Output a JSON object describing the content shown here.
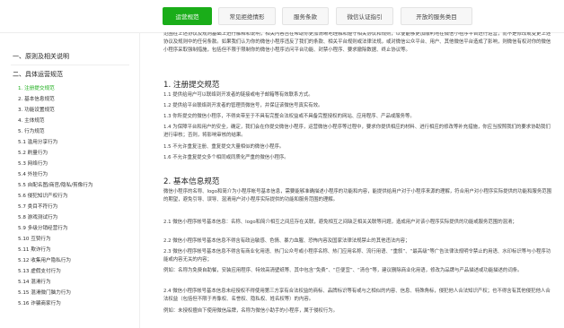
{
  "tabs": [
    {
      "label": "运营规范"
    },
    {
      "label": "常见拒绝情形"
    },
    {
      "label": "服务条款"
    },
    {
      "label": "微信认证指引"
    },
    {
      "label": "开放的服务类目"
    }
  ],
  "sidebar": {
    "sections": [
      {
        "label": "一、原则及相关说明"
      },
      {
        "label": "二、具体运营规范"
      }
    ],
    "items": [
      {
        "label": "1. 注册提交规范"
      },
      {
        "label": "2. 基本信息规范"
      },
      {
        "label": "3. 功能设置规范"
      },
      {
        "label": "4. 主体规范"
      },
      {
        "label": "5. 行为规范"
      },
      {
        "label": "5.1 滥用分享行为"
      },
      {
        "label": "5.2 刷量行为"
      },
      {
        "label": "5.3 网络行为"
      },
      {
        "label": "5.4 外挂行为"
      },
      {
        "label": "5.5 自配名图/商官/隐私/剪像行为"
      },
      {
        "label": "5.6 侵犯知识产权行为"
      },
      {
        "label": "5.7 类目不符行为"
      },
      {
        "label": "5.8 游戏测试行为"
      },
      {
        "label": "5.9 多级分销经营行为"
      },
      {
        "label": "5.10 互赞行为"
      },
      {
        "label": "5.11 欺诈行为"
      },
      {
        "label": "5.12 收集用户隐私行为"
      },
      {
        "label": "5.13 虚假支付行为"
      },
      {
        "label": "5.14 混淆行为"
      },
      {
        "label": "5.15 混淆微门脑力行为"
      },
      {
        "label": "5.16 诈骗商家行为"
      }
    ]
  },
  "content": {
    "intro": "范围在上述协议及规则基础上进行解释和说明，相关内容旨在帮助你更加清晰地理解和遵守相关协议和规则，以便能够更加顺利地在微信小程序平台进行运营，而不是修改或变更上述协议及规则中的任何条款。如果我们认为你的微信小程序违反了我们的条款、相关平台规则或法律法规，或对微信公众平台、用户、其他微信平台造成了影响，则微信有权对你的微信小程序采取强制措施，包括但不限于限制你的微信小程序访问平台功能、封禁小程序、要求撤除数据、终止协议等。",
    "section1": {
      "title": "1. 注册提交规范",
      "items": [
        "1.1 提供给用户可以联络到开发者的链接或电子邮箱等有效联系方式。",
        "1.2 提供给平台联络到开发者的管理员微信号，并保证该微信号真实有效。",
        "1.3 你所提交的微信小程序，不得夹带至于不具有完整合法权益或不具备完整授权的网站、应用程序、产品或服务等。",
        "1.4 为保障平台和用户的安全，确定，我们会在你提交微信小程序，运营微信小程序等过程中，要求你提供相应的材料、进行相应的修改等补充措施，你应当按照我们的要求协助我们进行审核；否则，将影响审核的结果。",
        "1.5 不允许重复注册、重复提交大量相似的微信小程序。",
        "1.6 不允许重复提交多个相同或同质化严重的微信小程序。"
      ]
    },
    "section2": {
      "title": "2. 基本信息规范",
      "intro": "微信小程序的名称、logo和简介为小程序帐号基本信息，需要能够准确描述小程序的功能和内容，能提供给用户对于小程序来源的理解，符合用户对小程序实际提供的功能和服务范围的期望，避免引导、误导、混淆用户对小程序实际提供的功能和服务范围的理解。",
      "items": [
        "2.1 微信小程序帐号基本信息：名称、logo和简介相互之间应存在关联，避免相互之间缺乏相关关联等问题，造成用户对该小程序实际提供的功能或服务范围的混淆；",
        "2.2 微信小程序帐号基本信息不得含有政治敏感、色情、暴力血腥、恐怖内容及国家法律法规禁止的其他违法内容；",
        "2.3 微信小程序帐号基本信息不得含有商业化用语、热门公众号或小程序名称、热门应用名称、流行用语、“重叙”、“最高级”等广告法律法规明令禁止的用语、水印标识等与小程序功能或内容无关的内容；",
        "例如：名称为免费自助餐，安装应用程序、特效高清壁纸等、其中包含“免费”、“巨便宜”、“清仓”等，建议删除商业化用语，修改为品牌与产品描述或功能描述的词条。",
        "2.4 微信小程序帐号基本信息未经授权不得使用第三方享有合法权益的商标、品牌标识等有或与之相似的内容、信息、特殊角标，侵犯他人合法知识产权；也不得含有其他侵犯他人合法权益（包括但不限于肖像权、名誉权、隐私权、姓名权等）的内容。",
        "例如：未授权擅自下使用微信品牌，名称为微信小助手的小程序，属于侵权行为。"
      ]
    }
  }
}
